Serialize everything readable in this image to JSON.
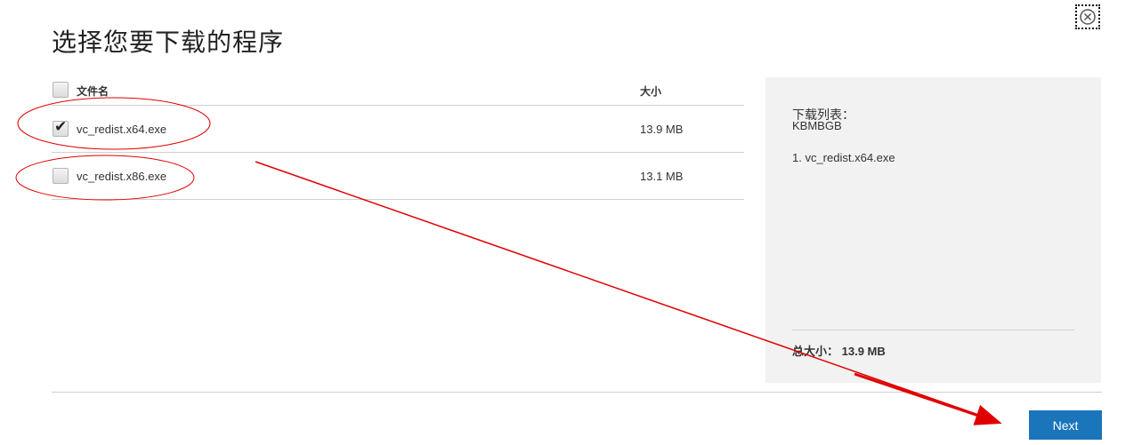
{
  "page": {
    "title": "选择您要下载的程序"
  },
  "table": {
    "header": {
      "name": "文件名",
      "size": "大小",
      "checked": false
    },
    "rows": [
      {
        "name": "vc_redist.x64.exe",
        "size": "13.9 MB",
        "checked": true
      },
      {
        "name": "vc_redist.x86.exe",
        "size": "13.1 MB",
        "checked": false
      }
    ]
  },
  "panel": {
    "title": "下载列表：",
    "size_text": "KBMBGB",
    "items": [
      "1. vc_redist.x64.exe"
    ],
    "total_label": "总大小：",
    "total_value": "13.9 MB"
  },
  "buttons": {
    "next": "Next"
  },
  "icons": {
    "close": "close-icon",
    "checkmark": "checkmark-icon",
    "annotation": "red-ellipse-and-arrow"
  },
  "colors": {
    "primary": "#1b75bb",
    "panel_bg": "#f2f2f2",
    "annotation": "#e00000"
  }
}
